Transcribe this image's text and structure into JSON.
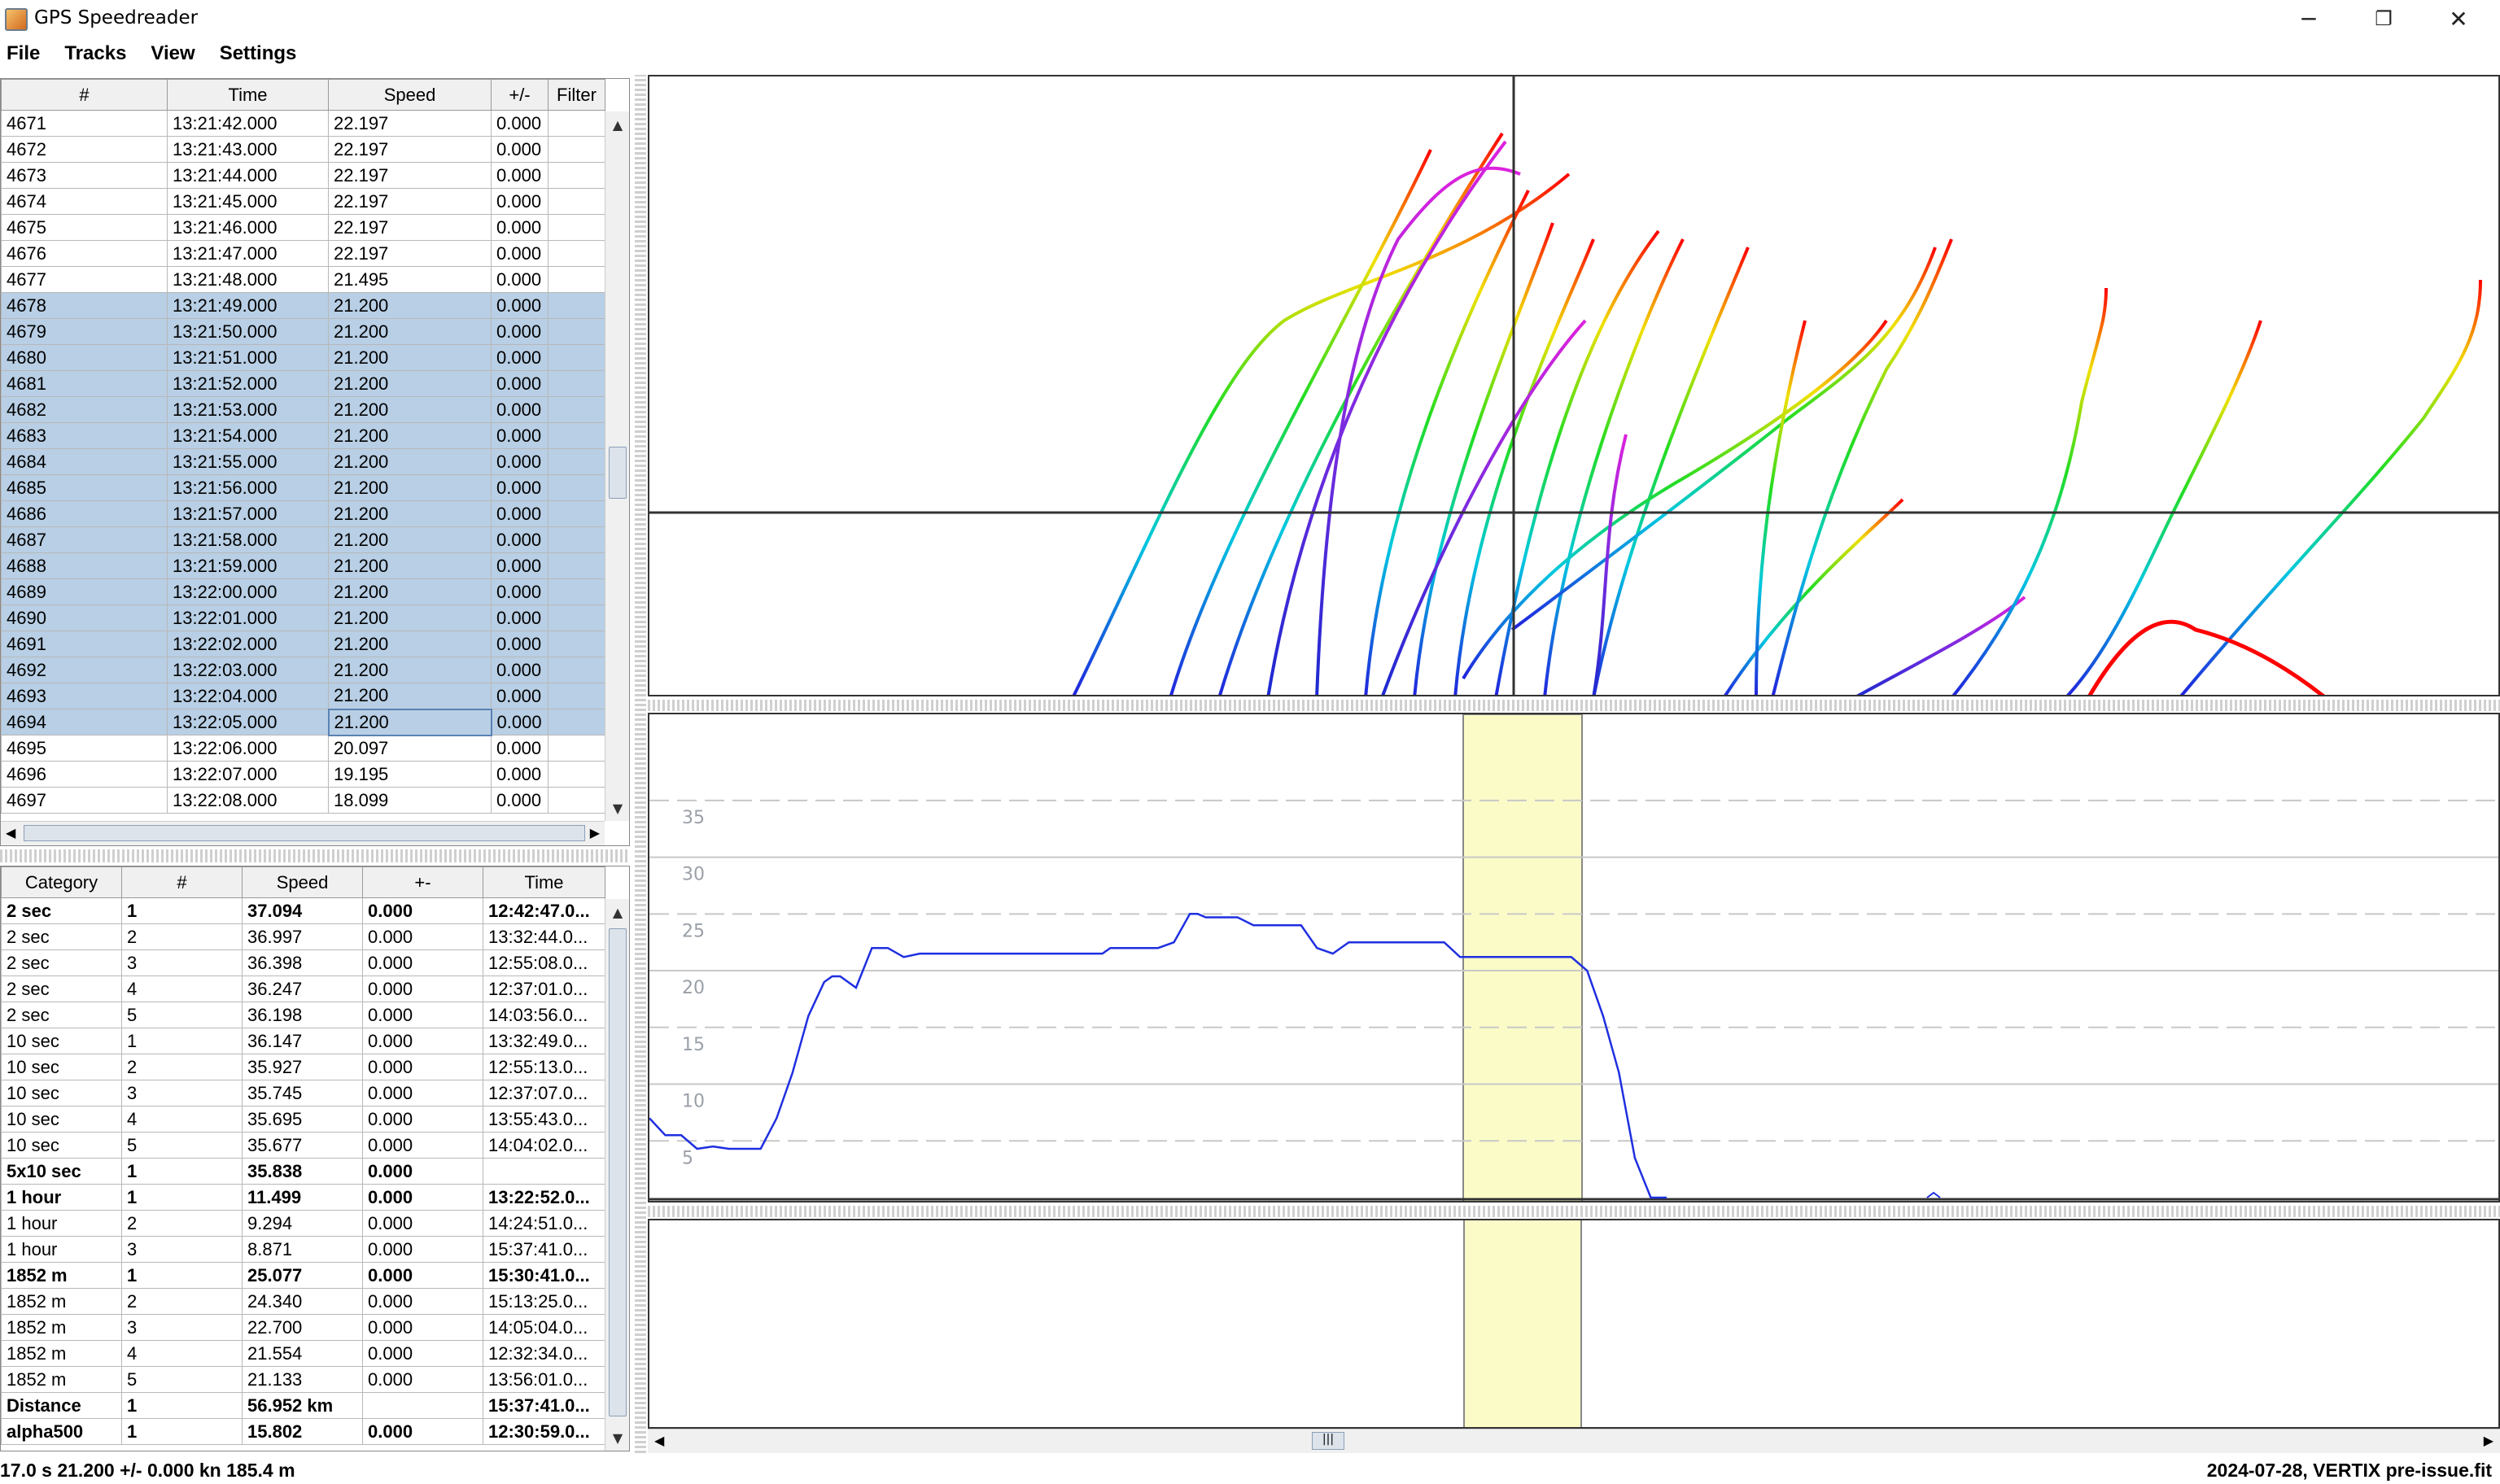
{
  "window": {
    "title": "GPS Speedreader",
    "minimize": "─",
    "maximize": "❐",
    "close": "✕"
  },
  "menu": [
    "File",
    "Tracks",
    "View",
    "Settings"
  ],
  "points_table": {
    "headers": [
      "#",
      "Time",
      "Speed",
      "+/-",
      "Filter"
    ],
    "rows": [
      [
        "4671",
        "13:21:42.000",
        "22.197",
        "0.000",
        ""
      ],
      [
        "4672",
        "13:21:43.000",
        "22.197",
        "0.000",
        ""
      ],
      [
        "4673",
        "13:21:44.000",
        "22.197",
        "0.000",
        ""
      ],
      [
        "4674",
        "13:21:45.000",
        "22.197",
        "0.000",
        ""
      ],
      [
        "4675",
        "13:21:46.000",
        "22.197",
        "0.000",
        ""
      ],
      [
        "4676",
        "13:21:47.000",
        "22.197",
        "0.000",
        ""
      ],
      [
        "4677",
        "13:21:48.000",
        "21.495",
        "0.000",
        ""
      ],
      [
        "4678",
        "13:21:49.000",
        "21.200",
        "0.000",
        ""
      ],
      [
        "4679",
        "13:21:50.000",
        "21.200",
        "0.000",
        ""
      ],
      [
        "4680",
        "13:21:51.000",
        "21.200",
        "0.000",
        ""
      ],
      [
        "4681",
        "13:21:52.000",
        "21.200",
        "0.000",
        ""
      ],
      [
        "4682",
        "13:21:53.000",
        "21.200",
        "0.000",
        ""
      ],
      [
        "4683",
        "13:21:54.000",
        "21.200",
        "0.000",
        ""
      ],
      [
        "4684",
        "13:21:55.000",
        "21.200",
        "0.000",
        ""
      ],
      [
        "4685",
        "13:21:56.000",
        "21.200",
        "0.000",
        ""
      ],
      [
        "4686",
        "13:21:57.000",
        "21.200",
        "0.000",
        ""
      ],
      [
        "4687",
        "13:21:58.000",
        "21.200",
        "0.000",
        ""
      ],
      [
        "4688",
        "13:21:59.000",
        "21.200",
        "0.000",
        ""
      ],
      [
        "4689",
        "13:22:00.000",
        "21.200",
        "0.000",
        ""
      ],
      [
        "4690",
        "13:22:01.000",
        "21.200",
        "0.000",
        ""
      ],
      [
        "4691",
        "13:22:02.000",
        "21.200",
        "0.000",
        ""
      ],
      [
        "4692",
        "13:22:03.000",
        "21.200",
        "0.000",
        ""
      ],
      [
        "4693",
        "13:22:04.000",
        "21.200",
        "0.000",
        ""
      ],
      [
        "4694",
        "13:22:05.000",
        "21.200",
        "0.000",
        ""
      ],
      [
        "4695",
        "13:22:06.000",
        "20.097",
        "0.000",
        ""
      ],
      [
        "4696",
        "13:22:07.000",
        "19.195",
        "0.000",
        ""
      ],
      [
        "4697",
        "13:22:08.000",
        "18.099",
        "0.000",
        ""
      ]
    ],
    "selected_from": 7,
    "selected_to": 23
  },
  "results_table": {
    "headers": [
      "Category",
      "#",
      "Speed",
      "+-",
      "Time"
    ],
    "rows": [
      {
        "c": [
          "2 sec",
          "1",
          "37.094",
          "0.000",
          "12:42:47.0..."
        ],
        "b": true
      },
      {
        "c": [
          "2 sec",
          "2",
          "36.997",
          "0.000",
          "13:32:44.0..."
        ],
        "b": false
      },
      {
        "c": [
          "2 sec",
          "3",
          "36.398",
          "0.000",
          "12:55:08.0..."
        ],
        "b": false
      },
      {
        "c": [
          "2 sec",
          "4",
          "36.247",
          "0.000",
          "12:37:01.0..."
        ],
        "b": false
      },
      {
        "c": [
          "2 sec",
          "5",
          "36.198",
          "0.000",
          "14:03:56.0..."
        ],
        "b": false
      },
      {
        "c": [
          "10 sec",
          "1",
          "36.147",
          "0.000",
          "13:32:49.0..."
        ],
        "b": false
      },
      {
        "c": [
          "10 sec",
          "2",
          "35.927",
          "0.000",
          "12:55:13.0..."
        ],
        "b": false
      },
      {
        "c": [
          "10 sec",
          "3",
          "35.745",
          "0.000",
          "12:37:07.0..."
        ],
        "b": false
      },
      {
        "c": [
          "10 sec",
          "4",
          "35.695",
          "0.000",
          "13:55:43.0..."
        ],
        "b": false
      },
      {
        "c": [
          "10 sec",
          "5",
          "35.677",
          "0.000",
          "14:04:02.0..."
        ],
        "b": false
      },
      {
        "c": [
          "5x10 sec",
          "1",
          "35.838",
          "0.000",
          ""
        ],
        "b": true
      },
      {
        "c": [
          "1 hour",
          "1",
          "11.499",
          "0.000",
          "13:22:52.0..."
        ],
        "b": true
      },
      {
        "c": [
          "1 hour",
          "2",
          "9.294",
          "0.000",
          "14:24:51.0..."
        ],
        "b": false
      },
      {
        "c": [
          "1 hour",
          "3",
          "8.871",
          "0.000",
          "15:37:41.0..."
        ],
        "b": false
      },
      {
        "c": [
          "1852 m",
          "1",
          "25.077",
          "0.000",
          "15:30:41.0..."
        ],
        "b": true
      },
      {
        "c": [
          "1852 m",
          "2",
          "24.340",
          "0.000",
          "15:13:25.0..."
        ],
        "b": false
      },
      {
        "c": [
          "1852 m",
          "3",
          "22.700",
          "0.000",
          "14:05:04.0..."
        ],
        "b": false
      },
      {
        "c": [
          "1852 m",
          "4",
          "21.554",
          "0.000",
          "12:32:34.0..."
        ],
        "b": false
      },
      {
        "c": [
          "1852 m",
          "5",
          "21.133",
          "0.000",
          "13:56:01.0..."
        ],
        "b": false
      },
      {
        "c": [
          "Distance",
          "1",
          "56.952 km",
          "",
          "15:37:41.0..."
        ],
        "b": true
      },
      {
        "c": [
          "alpha500",
          "1",
          "15.802",
          "0.000",
          "12:30:59.0..."
        ],
        "b": true
      }
    ]
  },
  "speed_chart": {
    "ticks": [
      "35",
      "30",
      "25",
      "20",
      "15",
      "10",
      "5"
    ],
    "highlight_color": "#fbfbc8",
    "line_color": "#1f2fe0"
  },
  "chart_data": {
    "type": "line",
    "ylim": [
      0,
      38
    ],
    "yticks": [
      5,
      10,
      15,
      20,
      25,
      30,
      35
    ],
    "x": [
      0,
      10,
      20,
      30,
      40,
      50,
      60,
      70,
      80,
      90,
      100,
      110,
      115,
      120,
      130,
      140,
      150,
      160,
      170,
      180,
      190,
      200,
      210,
      220,
      230,
      240,
      250,
      260,
      270,
      275,
      280,
      285,
      290,
      295,
      300,
      310,
      320,
      330,
      340,
      345,
      350,
      360,
      370,
      380,
      390,
      400,
      410,
      420,
      430,
      440,
      450,
      460,
      470,
      480,
      490,
      500,
      510,
      520,
      530,
      540,
      550,
      560,
      570,
      580,
      590,
      600,
      610,
      620,
      630,
      635,
      640
    ],
    "y": [
      7,
      5.5,
      5.5,
      4.3,
      4.5,
      4.3,
      4.3,
      4.3,
      7,
      11,
      16,
      19,
      19.5,
      19.5,
      18.5,
      22,
      22,
      21.2,
      21.5,
      21.5,
      21.5,
      21.5,
      21.5,
      21.5,
      21.5,
      21.5,
      21.5,
      21.5,
      21.5,
      21.5,
      21.5,
      21.5,
      22,
      22,
      22,
      22,
      22,
      22.5,
      25,
      25,
      24.7,
      24.7,
      24.7,
      24,
      24,
      24,
      24,
      22,
      21.5,
      22.5,
      22.5,
      22.5,
      22.5,
      22.5,
      22.5,
      22.5,
      21.2,
      21.2,
      21.2,
      21.2,
      21.2,
      21.2,
      21.2,
      21.2,
      20,
      16,
      11,
      3.5,
      0,
      0,
      0
    ]
  },
  "status": {
    "left": "17.0 s 21.200 +/- 0.000 kn  185.4 m",
    "right": "2024-07-28, VERTIX pre-issue.fit"
  }
}
